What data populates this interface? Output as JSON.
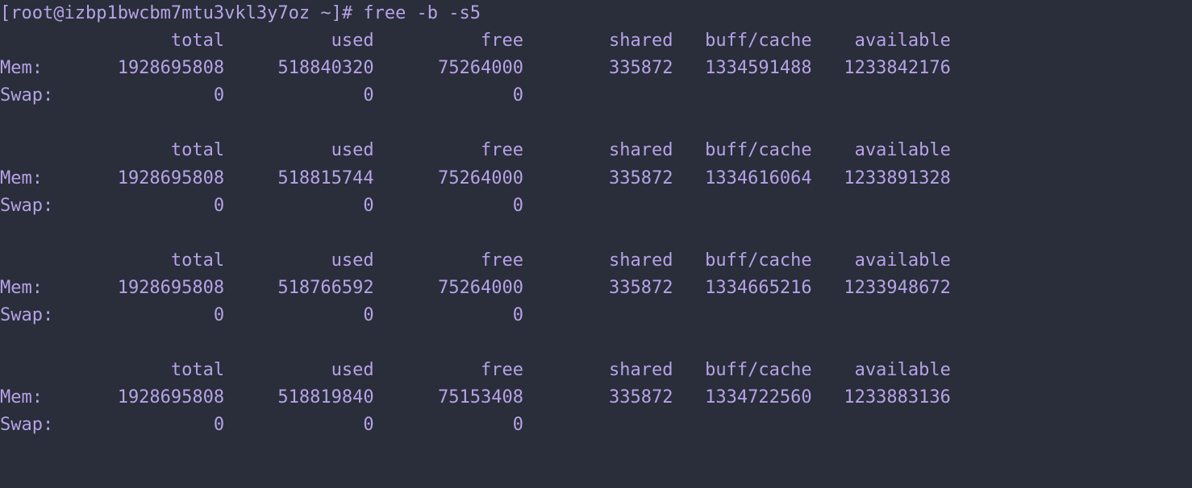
{
  "prompt": "[root@izbp1bwcbm7mtu3vkl3y7oz ~]# free -b -s5",
  "headers": [
    "total",
    "used",
    "free",
    "shared",
    "buff/cache",
    "available"
  ],
  "rowLabels": {
    "mem": "Mem:",
    "swap": "Swap:"
  },
  "blocks": [
    {
      "mem": [
        "1928695808",
        "518840320",
        "75264000",
        "335872",
        "1334591488",
        "1233842176"
      ],
      "swap": [
        "0",
        "0",
        "0"
      ]
    },
    {
      "mem": [
        "1928695808",
        "518815744",
        "75264000",
        "335872",
        "1334616064",
        "1233891328"
      ],
      "swap": [
        "0",
        "0",
        "0"
      ]
    },
    {
      "mem": [
        "1928695808",
        "518766592",
        "75264000",
        "335872",
        "1334665216",
        "1233948672"
      ],
      "swap": [
        "0",
        "0",
        "0"
      ]
    },
    {
      "mem": [
        "1928695808",
        "518819840",
        "75153408",
        "335872",
        "1334722560",
        "1233883136"
      ],
      "swap": [
        "0",
        "0",
        "0"
      ]
    }
  ]
}
